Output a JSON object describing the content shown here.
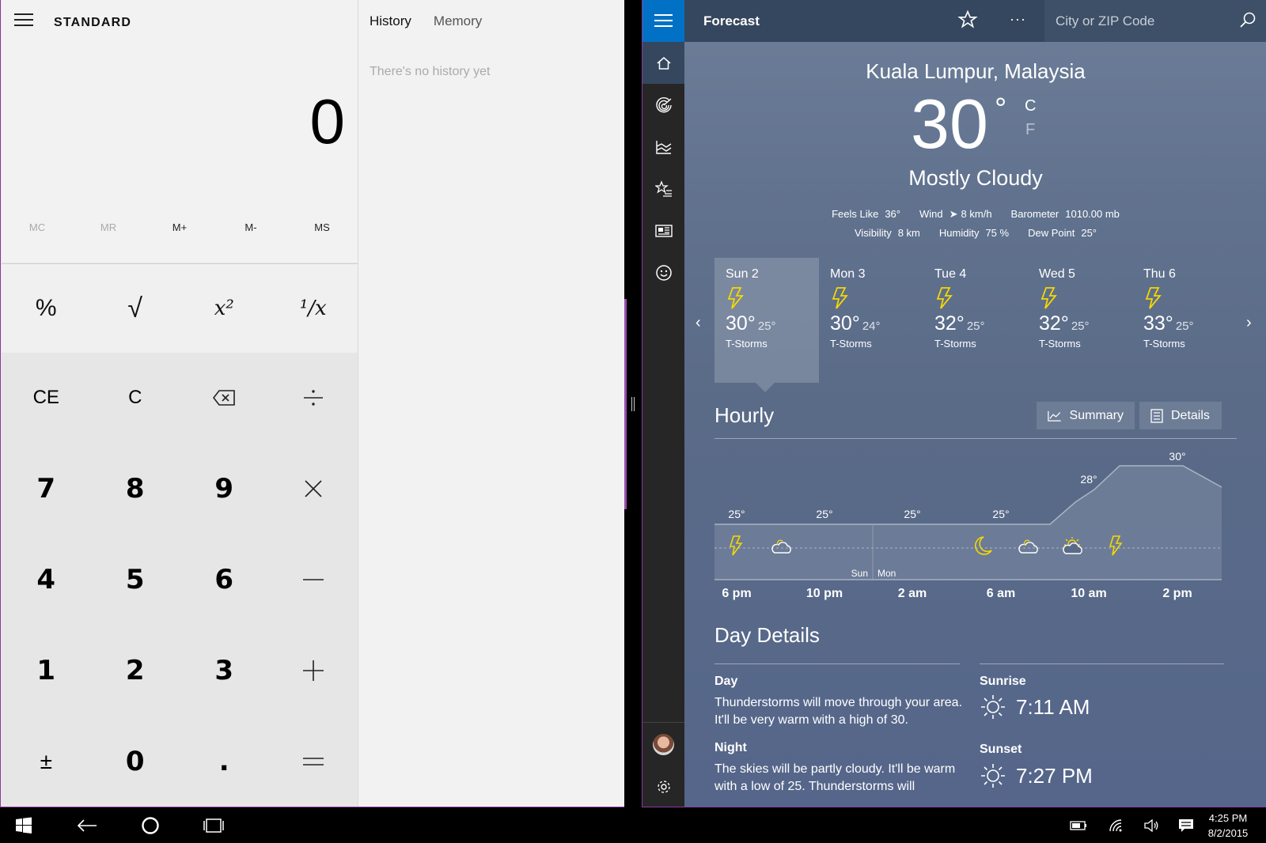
{
  "calculator": {
    "mode": "STANDARD",
    "display": "0",
    "memory": [
      "MC",
      "MR",
      "M+",
      "M-",
      "MS"
    ],
    "history_tabs": [
      "History",
      "Memory"
    ],
    "history_empty": "There's no history yet",
    "sci": {
      "percent": "%",
      "sqrt": "√",
      "square": "x²",
      "recip": "¹/x"
    },
    "keys": {
      "ce": "CE",
      "c": "C",
      "k7": "7",
      "k8": "8",
      "k9": "9",
      "k4": "4",
      "k5": "5",
      "k6": "6",
      "k1": "1",
      "k2": "2",
      "k3": "3",
      "negate": "±",
      "k0": "0",
      "dot": "."
    }
  },
  "weather": {
    "title": "Forecast",
    "search_placeholder": "City or ZIP Code",
    "location": "Kuala Lumpur, Malaysia",
    "temp": "30",
    "degree": "°",
    "unit_c": "C",
    "unit_f": "F",
    "condition": "Mostly Cloudy",
    "stats1": [
      {
        "label": "Feels Like",
        "value": "36°"
      },
      {
        "label": "Wind",
        "value": "8 km/h"
      },
      {
        "label": "Barometer",
        "value": "1010.00 mb"
      }
    ],
    "stats2": [
      {
        "label": "Visibility",
        "value": "8 km"
      },
      {
        "label": "Humidity",
        "value": "75 %"
      },
      {
        "label": "Dew Point",
        "value": "25°"
      }
    ],
    "days": [
      {
        "name": "Sun 2",
        "high": "30°",
        "low": "25°",
        "cond": "T-Storms"
      },
      {
        "name": "Mon 3",
        "high": "30°",
        "low": "24°",
        "cond": "T-Storms"
      },
      {
        "name": "Tue 4",
        "high": "32°",
        "low": "25°",
        "cond": "T-Storms"
      },
      {
        "name": "Wed 5",
        "high": "32°",
        "low": "25°",
        "cond": "T-Storms"
      },
      {
        "name": "Thu 6",
        "high": "33°",
        "low": "25°",
        "cond": "T-Storms"
      }
    ],
    "hourly": {
      "title": "Hourly",
      "summary_label": "Summary",
      "details_label": "Details",
      "times": [
        "6 pm",
        "10 pm",
        "2 am",
        "6 am",
        "10 am",
        "2 pm"
      ],
      "temp_labels": [
        "25°",
        "25°",
        "25°",
        "25°",
        "28°",
        "30°"
      ],
      "day_marks": [
        "Sun",
        "Mon"
      ],
      "icons": [
        "lightning-icon",
        "cloud-night-icon",
        "moon-icon",
        "cloud-night-icon",
        "partly-sunny-icon",
        "lightning-icon"
      ]
    },
    "day_details": {
      "title": "Day Details",
      "day_h": "Day",
      "day_text": "Thunderstorms will move through your area. It'll be very warm with a high of 30.",
      "night_h": "Night",
      "night_text": "The skies will be partly cloudy. It'll be warm with a low of 25. Thunderstorms will",
      "sunrise_h": "Sunrise",
      "sunrise": "7:11 AM",
      "sunset_h": "Sunset",
      "sunset": "7:27 PM"
    },
    "colors": {
      "accent": "#0071c5",
      "lightning": "#f5d800"
    }
  },
  "taskbar": {
    "time": "4:25 PM",
    "date": "8/2/2015"
  }
}
